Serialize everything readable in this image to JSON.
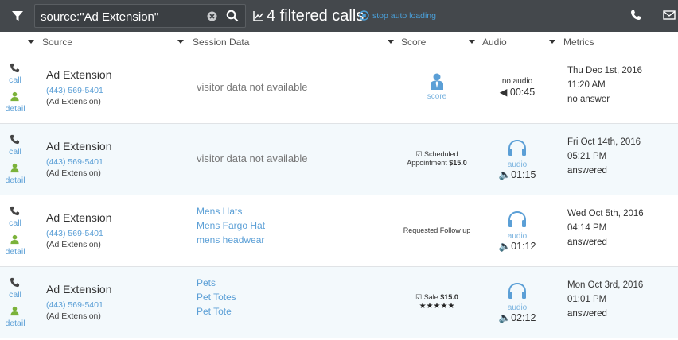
{
  "topbar": {
    "search_value": "source:\"Ad Extension\"",
    "count_label": "4 filtered calls",
    "stop_label": "stop auto loading",
    "colors": {
      "bar": "#44484c",
      "accent": "#4a9fd8"
    }
  },
  "columns": [
    "Source",
    "Session Data",
    "Score",
    "Audio",
    "Metrics"
  ],
  "actions": {
    "call": "call",
    "detail": "detail"
  },
  "rows": [
    {
      "source": {
        "name": "Ad Extension",
        "phone": "(443) 569-5401",
        "sub": "(Ad Extension)"
      },
      "session": {
        "empty": "visitor data not available"
      },
      "score": {
        "link": "score"
      },
      "audio": {
        "none": "no audio",
        "duration": "00:45"
      },
      "metrics": [
        "Thu Dec 1st, 2016",
        "11:20 AM",
        "no answer"
      ]
    },
    {
      "source": {
        "name": "Ad Extension",
        "phone": "(443) 569-5401",
        "sub": "(Ad Extension)"
      },
      "session": {
        "empty": "visitor data not available"
      },
      "score": {
        "line1": "Scheduled",
        "line2": "Appointment",
        "amount": "$15.0"
      },
      "audio": {
        "label": "audio",
        "duration": "01:15"
      },
      "metrics": [
        "Fri Oct 14th, 2016",
        "05:21 PM",
        "answered"
      ]
    },
    {
      "source": {
        "name": "Ad Extension",
        "phone": "(443) 569-5401",
        "sub": "(Ad Extension)"
      },
      "session": {
        "links": [
          "Mens Hats",
          "Mens Fargo Hat",
          "mens headwear"
        ]
      },
      "score": {
        "text": "Requested Follow up"
      },
      "audio": {
        "label": "audio",
        "duration": "01:12"
      },
      "metrics": [
        "Wed Oct 5th, 2016",
        "04:14 PM",
        "answered"
      ]
    },
    {
      "source": {
        "name": "Ad Extension",
        "phone": "(443) 569-5401",
        "sub": "(Ad Extension)"
      },
      "session": {
        "links": [
          "Pets",
          "Pet Totes",
          "Pet Tote"
        ]
      },
      "score": {
        "label": "Sale",
        "amount": "$15.0",
        "stars": "★★★★★",
        "rating": 5
      },
      "audio": {
        "label": "audio",
        "duration": "02:12"
      },
      "metrics": [
        "Mon Oct 3rd, 2016",
        "01:01 PM",
        "answered"
      ]
    }
  ]
}
